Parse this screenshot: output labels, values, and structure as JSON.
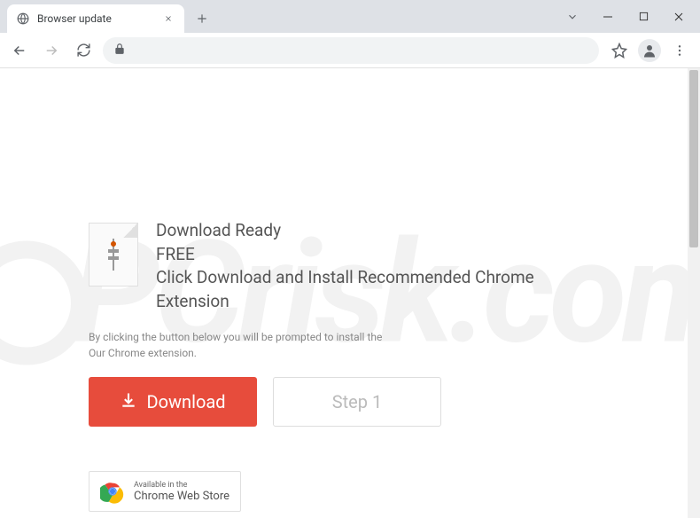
{
  "window": {
    "tab_title": "Browser update"
  },
  "page": {
    "heading_line1": "Download Ready",
    "heading_line2": "FREE",
    "heading_line3": "Click Download and Install Recommended Chrome Extension",
    "disclaimer_line1": "By clicking the button below you will be prompted to install the",
    "disclaimer_line2": "Our Chrome extension.",
    "download_button": "Download",
    "step_button": "Step 1",
    "webstore_line1": "Available in the",
    "webstore_line2": "Chrome Web Store"
  },
  "watermark": "PCrisk.com"
}
